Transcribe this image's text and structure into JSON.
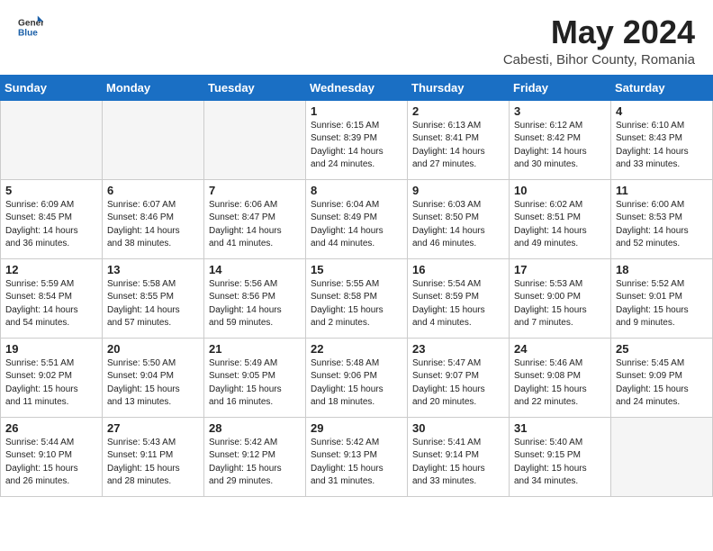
{
  "header": {
    "logo_general": "General",
    "logo_blue": "Blue",
    "month_title": "May 2024",
    "location": "Cabesti, Bihor County, Romania"
  },
  "days_of_week": [
    "Sunday",
    "Monday",
    "Tuesday",
    "Wednesday",
    "Thursday",
    "Friday",
    "Saturday"
  ],
  "weeks": [
    [
      {
        "day": "",
        "content": ""
      },
      {
        "day": "",
        "content": ""
      },
      {
        "day": "",
        "content": ""
      },
      {
        "day": "1",
        "content": "Sunrise: 6:15 AM\nSunset: 8:39 PM\nDaylight: 14 hours\nand 24 minutes."
      },
      {
        "day": "2",
        "content": "Sunrise: 6:13 AM\nSunset: 8:41 PM\nDaylight: 14 hours\nand 27 minutes."
      },
      {
        "day": "3",
        "content": "Sunrise: 6:12 AM\nSunset: 8:42 PM\nDaylight: 14 hours\nand 30 minutes."
      },
      {
        "day": "4",
        "content": "Sunrise: 6:10 AM\nSunset: 8:43 PM\nDaylight: 14 hours\nand 33 minutes."
      }
    ],
    [
      {
        "day": "5",
        "content": "Sunrise: 6:09 AM\nSunset: 8:45 PM\nDaylight: 14 hours\nand 36 minutes."
      },
      {
        "day": "6",
        "content": "Sunrise: 6:07 AM\nSunset: 8:46 PM\nDaylight: 14 hours\nand 38 minutes."
      },
      {
        "day": "7",
        "content": "Sunrise: 6:06 AM\nSunset: 8:47 PM\nDaylight: 14 hours\nand 41 minutes."
      },
      {
        "day": "8",
        "content": "Sunrise: 6:04 AM\nSunset: 8:49 PM\nDaylight: 14 hours\nand 44 minutes."
      },
      {
        "day": "9",
        "content": "Sunrise: 6:03 AM\nSunset: 8:50 PM\nDaylight: 14 hours\nand 46 minutes."
      },
      {
        "day": "10",
        "content": "Sunrise: 6:02 AM\nSunset: 8:51 PM\nDaylight: 14 hours\nand 49 minutes."
      },
      {
        "day": "11",
        "content": "Sunrise: 6:00 AM\nSunset: 8:53 PM\nDaylight: 14 hours\nand 52 minutes."
      }
    ],
    [
      {
        "day": "12",
        "content": "Sunrise: 5:59 AM\nSunset: 8:54 PM\nDaylight: 14 hours\nand 54 minutes."
      },
      {
        "day": "13",
        "content": "Sunrise: 5:58 AM\nSunset: 8:55 PM\nDaylight: 14 hours\nand 57 minutes."
      },
      {
        "day": "14",
        "content": "Sunrise: 5:56 AM\nSunset: 8:56 PM\nDaylight: 14 hours\nand 59 minutes."
      },
      {
        "day": "15",
        "content": "Sunrise: 5:55 AM\nSunset: 8:58 PM\nDaylight: 15 hours\nand 2 minutes."
      },
      {
        "day": "16",
        "content": "Sunrise: 5:54 AM\nSunset: 8:59 PM\nDaylight: 15 hours\nand 4 minutes."
      },
      {
        "day": "17",
        "content": "Sunrise: 5:53 AM\nSunset: 9:00 PM\nDaylight: 15 hours\nand 7 minutes."
      },
      {
        "day": "18",
        "content": "Sunrise: 5:52 AM\nSunset: 9:01 PM\nDaylight: 15 hours\nand 9 minutes."
      }
    ],
    [
      {
        "day": "19",
        "content": "Sunrise: 5:51 AM\nSunset: 9:02 PM\nDaylight: 15 hours\nand 11 minutes."
      },
      {
        "day": "20",
        "content": "Sunrise: 5:50 AM\nSunset: 9:04 PM\nDaylight: 15 hours\nand 13 minutes."
      },
      {
        "day": "21",
        "content": "Sunrise: 5:49 AM\nSunset: 9:05 PM\nDaylight: 15 hours\nand 16 minutes."
      },
      {
        "day": "22",
        "content": "Sunrise: 5:48 AM\nSunset: 9:06 PM\nDaylight: 15 hours\nand 18 minutes."
      },
      {
        "day": "23",
        "content": "Sunrise: 5:47 AM\nSunset: 9:07 PM\nDaylight: 15 hours\nand 20 minutes."
      },
      {
        "day": "24",
        "content": "Sunrise: 5:46 AM\nSunset: 9:08 PM\nDaylight: 15 hours\nand 22 minutes."
      },
      {
        "day": "25",
        "content": "Sunrise: 5:45 AM\nSunset: 9:09 PM\nDaylight: 15 hours\nand 24 minutes."
      }
    ],
    [
      {
        "day": "26",
        "content": "Sunrise: 5:44 AM\nSunset: 9:10 PM\nDaylight: 15 hours\nand 26 minutes."
      },
      {
        "day": "27",
        "content": "Sunrise: 5:43 AM\nSunset: 9:11 PM\nDaylight: 15 hours\nand 28 minutes."
      },
      {
        "day": "28",
        "content": "Sunrise: 5:42 AM\nSunset: 9:12 PM\nDaylight: 15 hours\nand 29 minutes."
      },
      {
        "day": "29",
        "content": "Sunrise: 5:42 AM\nSunset: 9:13 PM\nDaylight: 15 hours\nand 31 minutes."
      },
      {
        "day": "30",
        "content": "Sunrise: 5:41 AM\nSunset: 9:14 PM\nDaylight: 15 hours\nand 33 minutes."
      },
      {
        "day": "31",
        "content": "Sunrise: 5:40 AM\nSunset: 9:15 PM\nDaylight: 15 hours\nand 34 minutes."
      },
      {
        "day": "",
        "content": ""
      }
    ]
  ]
}
